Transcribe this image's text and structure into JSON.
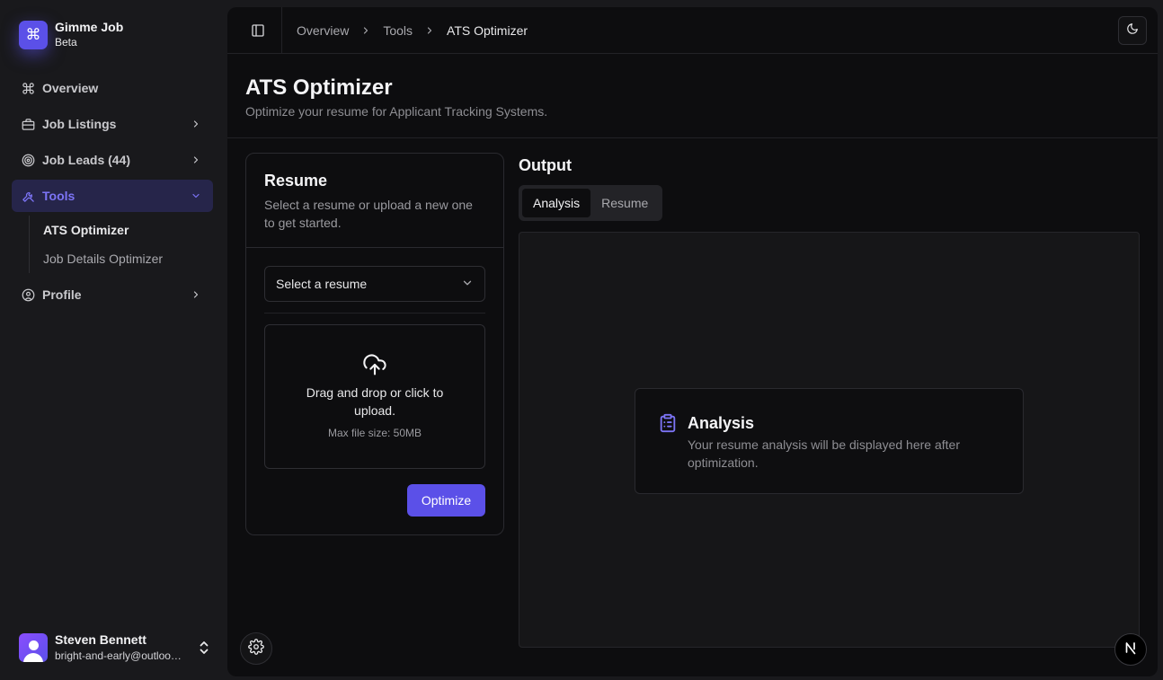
{
  "brand": {
    "name": "Gimme Job",
    "badge": "Beta",
    "logo_icon": "command-icon",
    "accent": "#5b50e8"
  },
  "sidebar": {
    "items": [
      {
        "label": "Overview",
        "icon": "command-icon"
      },
      {
        "label": "Job Listings",
        "icon": "briefcase-icon"
      },
      {
        "label": "Job Leads (44)",
        "icon": "target-icon"
      },
      {
        "label": "Tools",
        "icon": "tools-icon",
        "active": true,
        "children": [
          {
            "label": "ATS Optimizer",
            "current": true
          },
          {
            "label": "Job Details Optimizer"
          }
        ]
      },
      {
        "label": "Profile",
        "icon": "user-circle-icon"
      }
    ]
  },
  "user": {
    "name": "Steven Bennett",
    "email": "bright-and-early@outlook.com"
  },
  "breadcrumb": [
    "Overview",
    "Tools",
    "ATS Optimizer"
  ],
  "page": {
    "title": "ATS Optimizer",
    "subtitle": "Optimize your resume for Applicant Tracking Systems."
  },
  "resume_card": {
    "title": "Resume",
    "description": "Select a resume or upload a new one to get started.",
    "select_placeholder": "Select a resume",
    "upload_text": "Drag and drop or click to upload.",
    "max_size": "Max file size: 50MB",
    "optimize_label": "Optimize"
  },
  "output": {
    "title": "Output",
    "tabs": [
      {
        "label": "Analysis",
        "active": true
      },
      {
        "label": "Resume"
      }
    ],
    "analysis_title": "Analysis",
    "analysis_desc": "Your resume analysis will be displayed here after optimization."
  }
}
